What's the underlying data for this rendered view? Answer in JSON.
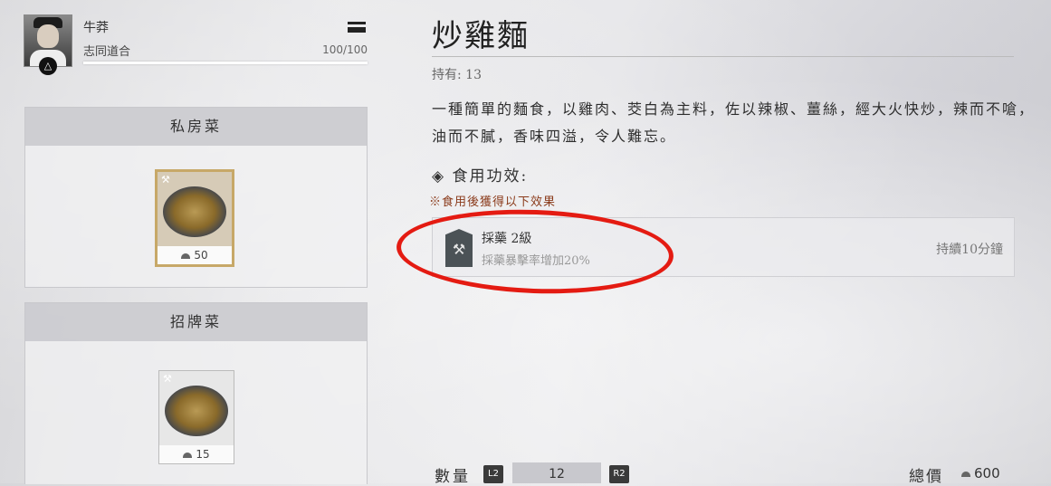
{
  "character": {
    "name": "牛莽",
    "relation": "志同道合",
    "hp": "100/100"
  },
  "categories": [
    {
      "title": "私房菜",
      "dishes": [
        {
          "price": "50",
          "selected": true,
          "icon": "gather-tool-icon"
        }
      ]
    },
    {
      "title": "招牌菜",
      "dishes": [
        {
          "price": "15",
          "selected": false,
          "icon": "gather-tool-icon"
        }
      ]
    }
  ],
  "detail": {
    "title": "炒雞麵",
    "owned_label": "持有:",
    "owned_value": "13",
    "description": "一種簡單的麵食，以雞肉、茭白為主料，佐以辣椒、薑絲，經大火快炒，辣而不嗆，油而不膩，香味四溢，令人難忘。",
    "effect_title": "◈ 食用功效:",
    "effect_note": "※食用後獲得以下效果",
    "effect": {
      "name": "採藥 2級",
      "desc": "採藥暴擊率增加20%",
      "duration": "持續10分鐘",
      "icon": "herb-gather-icon"
    }
  },
  "footer": {
    "qty_label": "數量",
    "qty_value": "12",
    "l2": "L2",
    "r2": "R2",
    "total_label": "總價",
    "total_value": "600"
  },
  "colors": {
    "highlight_circle": "#e41b12",
    "selected_border": "#c7a868",
    "note_text": "#8a3a1a"
  }
}
